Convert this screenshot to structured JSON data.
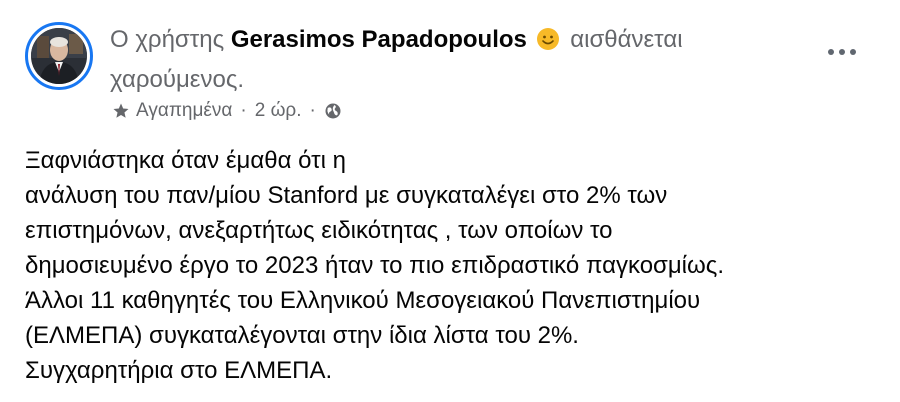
{
  "post": {
    "header": {
      "prefix": "Ο χρήστης",
      "author": "Gerasimos Papadopoulos",
      "feeling": "αισθάνεται χαρούμενος.",
      "emoji_icon": "smiley-face-icon"
    },
    "meta": {
      "favorites_icon": "star-icon",
      "audience": "Αγαπημένα",
      "separator": "·",
      "time": "2 ώρ.",
      "separator2": "·",
      "privacy_icon": "globe-icon"
    },
    "more_icon": "more-options-icon",
    "body_lines": [
      "Ξαφνιάστηκα όταν έμαθα ότι η",
      "ανάλυση του παν/μίου Stanford με συγκαταλέγει στο 2% των",
      "επιστημόνων, ανεξαρτήτως ειδικότητας , των οποίων το",
      "δημοσιευμένο έργο το 2023 ήταν το πιο επιδραστικό παγκοσμίως.",
      "Άλλοι 11 καθηγητές του Ελληνικού Μεσογειακού Πανεπιστημίου",
      "(ΕΛΜΕΠΑ) συγκαταλέγονται στην ίδια λίστα του 2%.",
      "Συγχαρητήρια στο ΕΛΜΕΠΑ."
    ],
    "colors": {
      "accent": "#1877f2",
      "secondary_text": "#65676b",
      "primary_text": "#050505",
      "emoji": "#f7b928"
    }
  }
}
